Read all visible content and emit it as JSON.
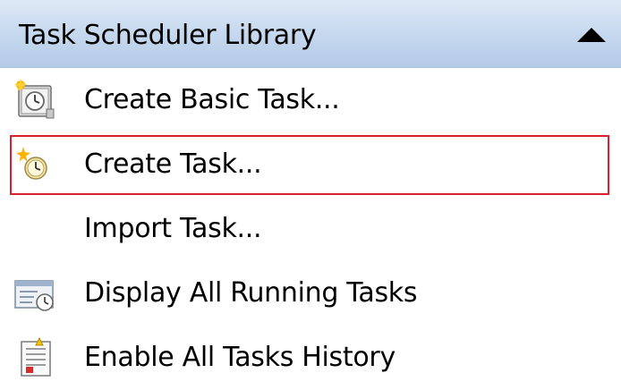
{
  "panel": {
    "title": "Task Scheduler Library",
    "collapse_icon": "triangle-up-icon"
  },
  "actions": [
    {
      "label": "Create Basic Task...",
      "icon": "basic-task-icon"
    },
    {
      "label": "Create Task...",
      "icon": "create-task-icon",
      "selected": true
    },
    {
      "label": "Import Task...",
      "icon": ""
    },
    {
      "label": "Display All Running Tasks",
      "icon": "running-tasks-icon"
    },
    {
      "label": "Enable All Tasks History",
      "icon": "tasks-history-icon"
    }
  ],
  "colors": {
    "header_gradient_top": "#dde9f6",
    "header_gradient_bottom": "#b5cbe6",
    "selection_border": "#d9202c"
  }
}
